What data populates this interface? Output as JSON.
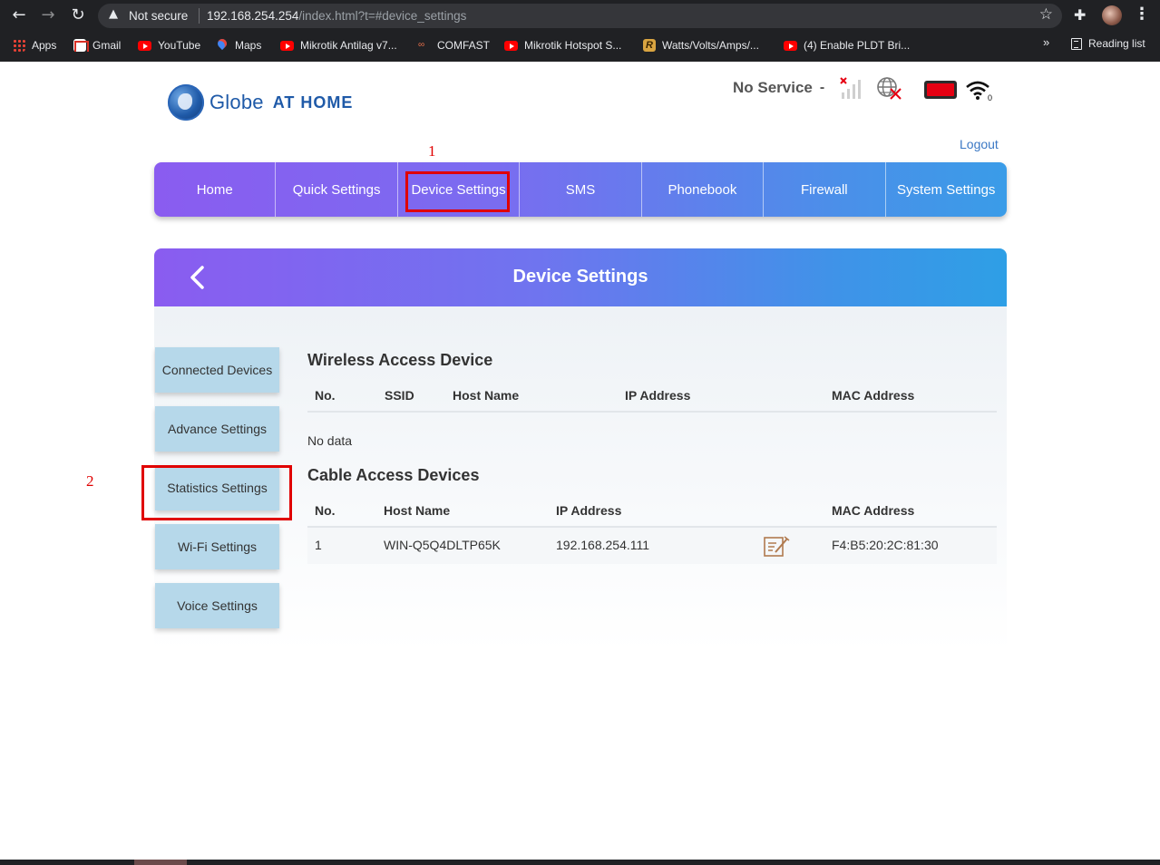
{
  "browser": {
    "not_secure": "Not secure",
    "url_host": "192.168.254.254",
    "url_path": "/index.html?t=#device_settings",
    "bookmarks": [
      {
        "label": "Apps",
        "icon": "apps-grid-icon"
      },
      {
        "label": "Gmail",
        "icon": "gmail-icon"
      },
      {
        "label": "YouTube",
        "icon": "youtube-icon"
      },
      {
        "label": "Maps",
        "icon": "maps-icon"
      },
      {
        "label": "Mikrotik Antilag v7...",
        "icon": "youtube-icon"
      },
      {
        "label": "COMFAST",
        "icon": "comfast-icon"
      },
      {
        "label": "Mikrotik Hotspot S...",
        "icon": "youtube-icon"
      },
      {
        "label": "Watts/Volts/Amps/...",
        "icon": "r-icon"
      },
      {
        "label": "(4) Enable PLDT Bri...",
        "icon": "youtube-icon"
      }
    ],
    "more_bookmarks": "»",
    "reading_list": "Reading list"
  },
  "header": {
    "logo_globe": "Globe",
    "logo_athome": "AT HOME",
    "status_text": "No Service",
    "status_dash": "-",
    "battery_color": "#e60012",
    "logout": "Logout"
  },
  "nav": {
    "items": [
      "Home",
      "Quick Settings",
      "Device Settings",
      "SMS",
      "Phonebook",
      "Firewall",
      "System Settings"
    ],
    "gradient_start": "#8a5cf0",
    "gradient_end": "#3a9ce8"
  },
  "annotations": {
    "label_1": "1",
    "label_2": "2",
    "color": "#e00000"
  },
  "panel": {
    "title": "Device Settings"
  },
  "sidebar": {
    "items": [
      "Connected Devices",
      "Advance Settings",
      "Statistics Settings",
      "Wi-Fi Settings",
      "Voice Settings"
    ],
    "button_color": "#b6d8ea"
  },
  "wireless": {
    "title": "Wireless Access Device",
    "columns": [
      "No.",
      "SSID",
      "Host Name",
      "IP Address",
      "MAC Address"
    ],
    "empty_text": "No data"
  },
  "cable": {
    "title": "Cable Access Devices",
    "columns": [
      "No.",
      "Host Name",
      "IP Address",
      "MAC Address"
    ],
    "rows": [
      {
        "no": "1",
        "host": "WIN-Q5Q4DLTP65K",
        "ip": "192.168.254.111",
        "mac": "F4:B5:20:2C:81:30",
        "action_icon": "edit-icon"
      }
    ]
  }
}
